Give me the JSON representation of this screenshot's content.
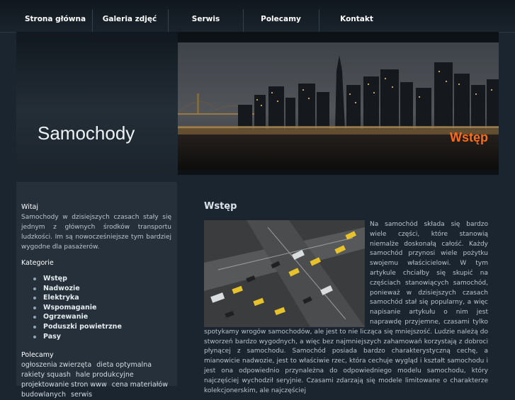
{
  "nav": {
    "items": [
      "Strona główna",
      "Galeria zdjęć",
      "Serwis",
      "Polecamy",
      "Kontakt"
    ]
  },
  "header": {
    "title": "Samochody",
    "tag": "Wstęp"
  },
  "sidebar": {
    "welcome_heading": "Witaj",
    "welcome_text": "Samochody w dzisiejszych czasach stały się jednym z głównych środków transportu ludzkości. Im są nowocześniejsze tym bardziej wygodne dla pasażerów.",
    "categories_heading": "Kategorie",
    "categories": [
      "Wstęp",
      "Nadwozie",
      "Elektryka",
      "Wspomaganie",
      "Ogrzewanie",
      "Poduszki powietrzne",
      "Pasy"
    ],
    "recommended_heading": "Polecamy",
    "links": [
      "ogłoszenia zwierzęta",
      "dieta optymalna",
      "rakiety squash",
      "hale produkcyjne",
      "projektowanie stron www",
      "cena materiałów budowlanych",
      "serwis"
    ]
  },
  "main": {
    "title": "Wstęp",
    "body": "Na samochód składa się bardzo wiele części, które stanowią niemalże doskonałą całość. Każdy samochód przynosi wiele pożytku swojemu właścicielowi. W tym artykule chciałby się skupić na częściach stanowiących samochód, ponieważ w dzisiejszych czasach samochód stał się popularny, a więc napisanie artykułu o nim jest naprawdę przyjemne, czasami tylko spotykamy wrogów samochodów, ale jest to nie licząca się mniejszość. Ludzie należą do stworzeń bardzo wygodnych, a więc bez najmniejszych zahamowań korzystają z dobroci płynącej z samochodu. Samochód posiada bardzo charakterystyczną cechę, a mianowicie nadwozie, jest to właściwie rzec, która cechuje wygląd i kształt samochodu i jest ona odpowiednio przynależna do odpowiedniego modelu samochodu, który najczęściej wychodził seryjnie. Czasami zdarzają się modele limitowane o charakterze kolekcjonerskim, ale najczęściej"
  }
}
